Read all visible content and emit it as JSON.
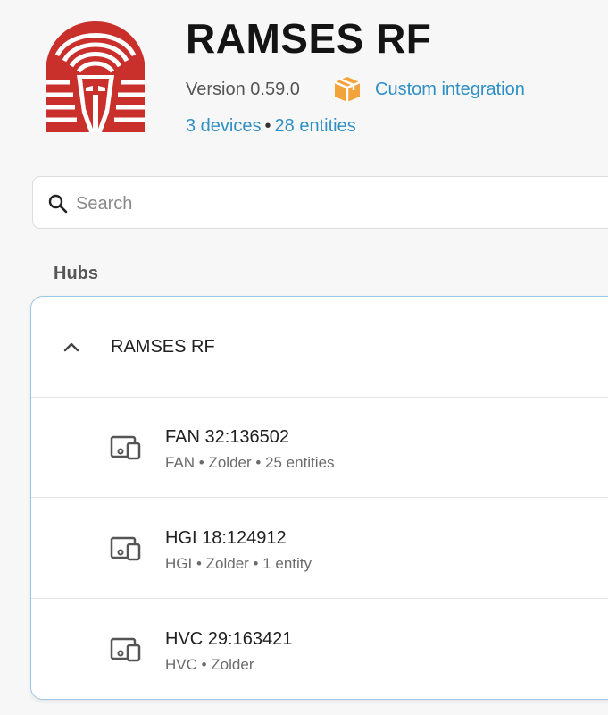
{
  "header": {
    "title": "RAMSES RF",
    "version": "Version 0.59.0",
    "custom_label": "Custom integration",
    "devices_link": "3 devices",
    "separator": "•",
    "entities_link": "28 entities",
    "logo_icon": "pharaoh-logo-icon",
    "custom_icon": "custom-integration-box-icon",
    "brand_color": "#c9302c",
    "link_color": "#2e8fc4",
    "custom_icon_color": "#f2a43a"
  },
  "search": {
    "placeholder": "Search",
    "value": ""
  },
  "section": {
    "label": "Hubs"
  },
  "hub": {
    "name": "RAMSES RF",
    "expanded": true,
    "devices": [
      {
        "name": "FAN 32:136502",
        "meta": "FAN • Zolder • 25 entities"
      },
      {
        "name": "HGI 18:124912",
        "meta": "HGI • Zolder • 1 entity"
      },
      {
        "name": "HVC 29:163421",
        "meta": "HVC • Zolder"
      }
    ]
  }
}
